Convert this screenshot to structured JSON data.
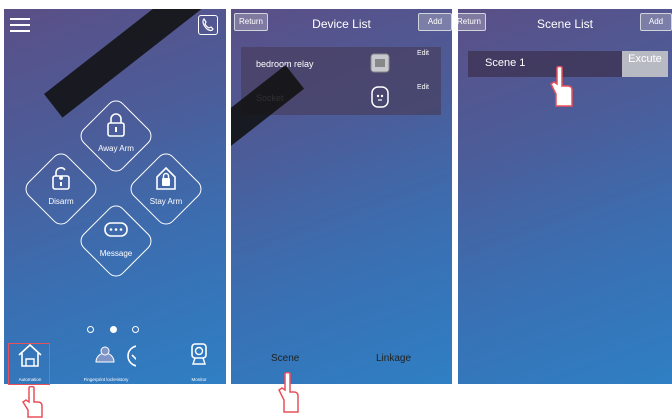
{
  "home_screen": {
    "buttons": {
      "away_arm": "Away Arm",
      "disarm": "Disarm",
      "stay_arm": "Stay Arm",
      "message": "Message"
    },
    "tabs": {
      "automation": "Automation",
      "fingerprint": "Fingerprint lockHistory",
      "monitor": "Monitor"
    }
  },
  "device_list": {
    "title": "Device List",
    "return_label": "Return",
    "add_label": "Add",
    "items": [
      {
        "name": "bedroom relay",
        "edit": "Edit",
        "icon": "relay-icon"
      },
      {
        "name": "Socket",
        "edit": "Edit",
        "icon": "socket-icon"
      }
    ],
    "bottom_tabs": {
      "scene": "Scene",
      "linkage": "Linkage"
    }
  },
  "scene_list": {
    "title": "Scene List",
    "return_label": "Return",
    "add_label": "Add",
    "scenes": [
      {
        "name": "Scene 1",
        "execute": "Excute"
      }
    ]
  },
  "colors": {
    "accent_red": "#e8505a",
    "panel_blue": "#3a6fb2",
    "panel_purple": "#5b4f86"
  }
}
